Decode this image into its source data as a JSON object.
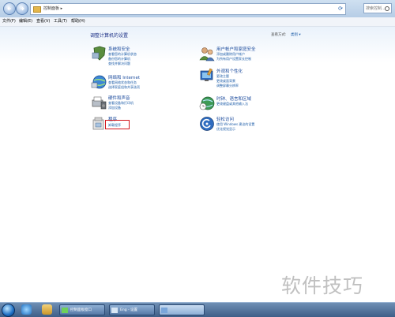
{
  "address": {
    "crumb": "控制面板 ▸",
    "search_placeholder": "搜索控制..."
  },
  "menu": [
    "文件(F)",
    "编辑(E)",
    "查看(V)",
    "工具(T)",
    "帮助(H)"
  ],
  "header": {
    "title": "调整计算机的设置",
    "view_by_label": "查看方式:",
    "view_by_value": "类别 ▾"
  },
  "categories": [
    {
      "title": "系统和安全",
      "links": [
        "查看您的计算机状态",
        "备份您的计算机",
        "查找并解决问题"
      ]
    },
    {
      "title": "网络和 Internet",
      "links": [
        "查看网络状态和任务",
        "选择家庭组和共享选项"
      ]
    },
    {
      "title": "硬件和声音",
      "links": [
        "查看设备和打印机",
        "添加设备"
      ]
    },
    {
      "title": "程序",
      "links": [
        "卸载程序"
      ]
    },
    {
      "title": "用户帐户和家庭安全",
      "links": [
        "添加或删除用户帐户",
        "为所有用户设置家长控制"
      ]
    },
    {
      "title": "外观和个性化",
      "links": [
        "更改主题",
        "更改桌面背景",
        "调整屏幕分辨率"
      ]
    },
    {
      "title": "时钟、语言和区域",
      "links": [
        "更改键盘或其他输入法"
      ]
    },
    {
      "title": "轻松访问",
      "links": [
        "使用 Windows 建议的设置",
        "优化视觉显示"
      ]
    }
  ],
  "taskbar": {
    "items": [
      "控制面板窗口",
      "Eng - 设置",
      ""
    ]
  },
  "watermark": "软件技巧",
  "colors": {
    "highlight_box": "#d4151b",
    "link": "#1c5ca8",
    "heading": "#1e3287"
  }
}
